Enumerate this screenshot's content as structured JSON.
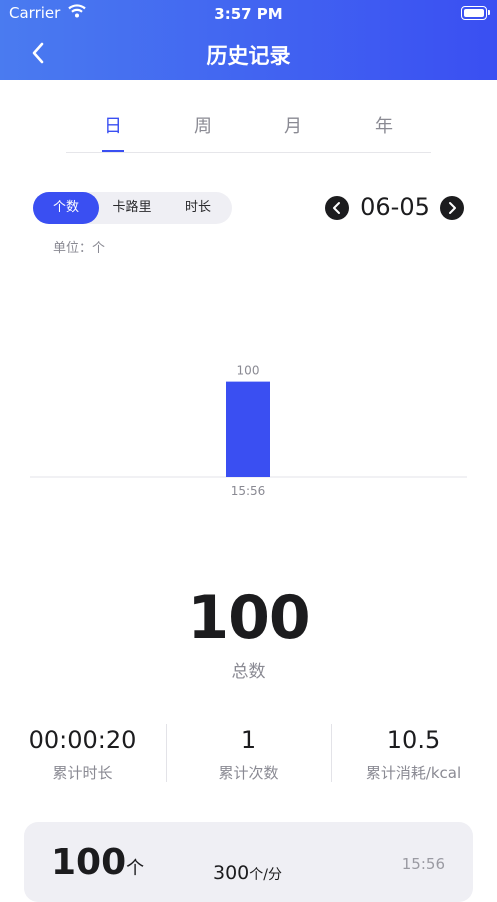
{
  "status_bar": {
    "carrier": "Carrier",
    "time": "3:57 PM"
  },
  "nav": {
    "title": "历史记录",
    "back_icon": "chevron-left-icon"
  },
  "tabs": [
    {
      "label": "日",
      "active": true
    },
    {
      "label": "周",
      "active": false
    },
    {
      "label": "月",
      "active": false
    },
    {
      "label": "年",
      "active": false
    }
  ],
  "metric_toggle": [
    {
      "label": "个数",
      "active": true
    },
    {
      "label": "卡路里",
      "active": false
    },
    {
      "label": "时长",
      "active": false
    }
  ],
  "date": {
    "label": "06-05",
    "prev_icon": "chevron-left-circle-icon",
    "next_icon": "chevron-right-circle-icon"
  },
  "unit_label": "单位：个",
  "chart_data": {
    "type": "bar",
    "categories": [
      "15:56"
    ],
    "values": [
      100
    ],
    "data_labels": [
      "100"
    ],
    "ylim": [
      0,
      130
    ],
    "grid": false,
    "color": "#3a4ff2"
  },
  "summary": {
    "total_value": "100",
    "total_label": "总数"
  },
  "stats": [
    {
      "value": "00:00:20",
      "label": "累计时长"
    },
    {
      "value": "1",
      "label": "累计次数"
    },
    {
      "value": "10.5",
      "label": "累计消耗/kcal"
    }
  ],
  "record_card": {
    "count": "100",
    "count_unit": "个",
    "rate": "300",
    "rate_unit": "个/分",
    "time": "15:56"
  },
  "colors": {
    "accent": "#3a4ff2",
    "header_gradient_start": "#4a7bf0",
    "header_gradient_end": "#3a4ff2"
  }
}
